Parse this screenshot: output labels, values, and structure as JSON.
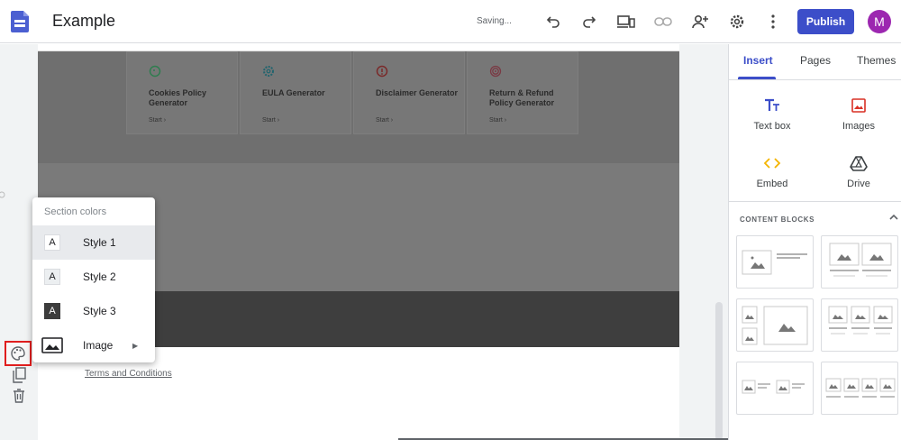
{
  "app": {
    "doc_title": "Example",
    "status": "Saving...",
    "publish_label": "Publish",
    "avatar_letter": "M"
  },
  "colors": {
    "accent": "#3c4ec9",
    "avatar": "#9c27b0",
    "highlight_box": "#e01e1e"
  },
  "toolbar_icons": [
    "undo-icon",
    "redo-icon",
    "device-preview-icon",
    "link-icon",
    "share-user-icon",
    "settings-icon",
    "more-icon"
  ],
  "page": {
    "cards": [
      {
        "title": "Cookies Policy Generator",
        "start": "Start ›",
        "icon": "cookie-icon"
      },
      {
        "title": "EULA Generator",
        "start": "Start ›",
        "icon": "gear-icon"
      },
      {
        "title": "Disclaimer Generator",
        "start": "Start ›",
        "icon": "alert-icon"
      },
      {
        "title": "Return & Refund Policy Generator",
        "start": "Start ›",
        "icon": "target-icon"
      }
    ],
    "footer_link": "Terms and Conditions"
  },
  "section_menu": {
    "heading": "Section colors",
    "items": [
      {
        "label": "Style 1",
        "icon_letter": "A",
        "selected": true
      },
      {
        "label": "Style 2",
        "icon_letter": "A"
      },
      {
        "label": "Style 3",
        "icon_letter": "A"
      },
      {
        "label": "Image",
        "submenu_arrow": "▶"
      }
    ]
  },
  "panel": {
    "tabs": [
      "Insert",
      "Pages",
      "Themes"
    ],
    "insert_items": [
      {
        "label": "Text box",
        "icon": "text-box-icon"
      },
      {
        "label": "Images",
        "icon": "image-icon"
      },
      {
        "label": "Embed",
        "icon": "embed-icon"
      },
      {
        "label": "Drive",
        "icon": "drive-icon"
      }
    ],
    "content_blocks_heading": "CONTENT BLOCKS"
  }
}
